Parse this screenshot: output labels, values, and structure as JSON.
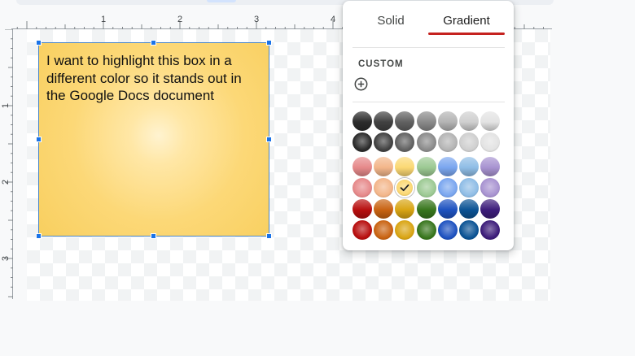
{
  "ruler": {
    "top_labels": [
      "1",
      "2",
      "3",
      "4"
    ],
    "left_labels": [
      "1",
      "2",
      "3"
    ]
  },
  "text_box": {
    "text": "I want to highlight this box in a\ndifferent color so it stands out in\nthe Google Docs document",
    "gradient_colors": [
      "#fff3d0",
      "#fcd877",
      "#f8cf5f"
    ],
    "border_color": "#4a86c8"
  },
  "fill_popup": {
    "tabs": [
      {
        "label": "Solid",
        "selected": false
      },
      {
        "label": "Gradient",
        "selected": true
      }
    ],
    "accent_color": "#c5221f",
    "custom_label": "CUSTOM",
    "add_icon": "add-circle-icon",
    "check_icon": "check-icon",
    "selected_swatch": {
      "row": 3,
      "col": 2
    },
    "swatch_rows": [
      [
        "#2b2b2b",
        "#414141",
        "#616161",
        "#8a8a8a",
        "#b4b4b4",
        "#cfcfcf",
        "#e3e3e3"
      ],
      [
        "#2b2b2b",
        "#414141",
        "#616161",
        "#8a8a8a",
        "#b4b4b4",
        "#cfcfcf",
        "#e3e3e3"
      ],
      [
        "#e6898a",
        "#f3b68a",
        "#fbd873",
        "#9cc993",
        "#7aa6ef",
        "#8fbde6",
        "#a893d1"
      ],
      [
        "#e6898a",
        "#f3b68a",
        "#fbd873",
        "#9cc993",
        "#7aa6ef",
        "#8fbde6",
        "#a893d1"
      ],
      [
        "#b80f0f",
        "#c96312",
        "#d9a514",
        "#38761d",
        "#1e52c0",
        "#0b5394",
        "#3d1d7a"
      ],
      [
        "#b80f0f",
        "#c96312",
        "#d9a514",
        "#38761d",
        "#1e52c0",
        "#0b5394",
        "#3d1d7a"
      ]
    ]
  }
}
